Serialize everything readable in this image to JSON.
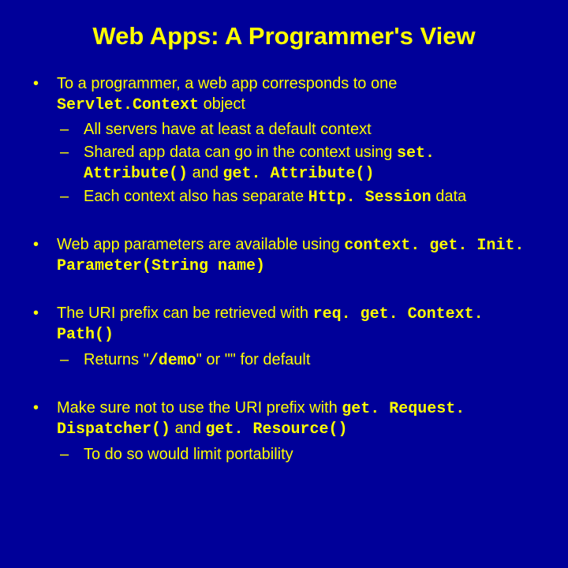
{
  "slide": {
    "title": "Web Apps: A Programmer's View",
    "b1_t1": "To a programmer, a web app corresponds to one ",
    "b1_c1": "Servlet.Context",
    "b1_t2": " object",
    "b1_s1": "All servers have at least a default context",
    "b1_s2_t1": "Shared app data can go in the context using ",
    "b1_s2_c1": "set. Attribute()",
    "b1_s2_t2": " and ",
    "b1_s2_c2": "get. Attribute()",
    "b1_s3_t1": "Each context also has separate ",
    "b1_s3_c1": "Http. Session",
    "b1_s3_t2": " data",
    "b2_t1": "Web app parameters are available using ",
    "b2_c1": "context. get. Init. Parameter(String name)",
    "b3_t1": "The URI prefix can be retrieved with ",
    "b3_c1": "req. get. Context. Path()",
    "b3_s1_t1": "Returns \"",
    "b3_s1_c1": "/demo",
    "b3_s1_t2": "\" or \"\" for default",
    "b4_t1": "Make sure not to use the URI prefix with ",
    "b4_c1": "get. Request. Dispatcher()",
    "b4_t2": " and ",
    "b4_c2": "get. Resource()",
    "b4_s1": "To do so would limit portability"
  }
}
